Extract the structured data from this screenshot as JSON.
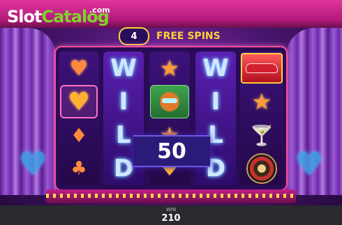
{
  "logo": {
    "slot": "Slot",
    "catalog": "Catalog",
    "com": ".com"
  },
  "free_spins": {
    "count": "4",
    "label": "FREE SPINS"
  },
  "reels": {
    "reel1": [
      "heart",
      "heart-framed",
      "diamond",
      "club"
    ],
    "reel2_letters": [
      "W",
      "I",
      "L",
      "D"
    ],
    "reel3": [
      "star",
      "fox-wild",
      "star",
      "heart"
    ],
    "reel4_letters": [
      "W",
      "I",
      "L",
      "D"
    ],
    "reel5": [
      "limo",
      "star",
      "martini",
      "roulette"
    ]
  },
  "win_overlay": {
    "amount": "50"
  },
  "bottom": {
    "win_label": "WIN",
    "win_amount": "210"
  },
  "colors": {
    "accent": "#ffd23a",
    "banner": "#e0359a",
    "reel_bg": "#2a0b55",
    "logo_green": "#7fd32b"
  }
}
